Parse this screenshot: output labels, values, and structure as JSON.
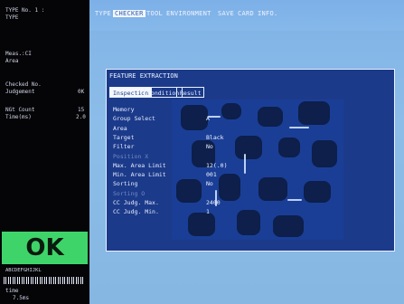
{
  "status": {
    "type_label": "TYPE No. 1 :",
    "type_value": "TYPE",
    "mode_label": "Meas.:CI",
    "mode_value": "Area",
    "checked_label": "Checked No.",
    "judgement_label": "Judgement",
    "judgement_value": "0K",
    "ngcount_label": "NGt Count",
    "ngcount_value": "15",
    "time_label": "Time(ms)",
    "time_value": "2.0",
    "result": "OK",
    "barcode_text": "ABCDEFGHIJKL",
    "bottom_label": "time",
    "bottom_value": "7.5ms"
  },
  "menu": {
    "items": [
      "TYPE",
      "CHECKER",
      "TOOL",
      "ENVIRONMENT",
      "SAVE",
      "CARD",
      "INFO."
    ],
    "active": "CHECKER"
  },
  "dialog": {
    "title": "FEATURE EXTRACTION",
    "tabs": [
      "Inspection",
      "Condition",
      "Result"
    ],
    "active_tab": "Inspection",
    "fields": [
      {
        "label": "Memory",
        "value": ""
      },
      {
        "label": "Group Select",
        "value": "A"
      },
      {
        "label": "Area",
        "value": ""
      },
      {
        "label": "Target",
        "value": "Black"
      },
      {
        "label": "Filter",
        "value": "No"
      },
      {
        "label": "Position X",
        "value": "",
        "dim": true
      },
      {
        "label": "Max. Area Limit",
        "value": "12(.0)"
      },
      {
        "label": "Min. Area Limit",
        "value": "001"
      },
      {
        "label": "Sorting",
        "value": "No"
      },
      {
        "label": "Sorting O",
        "value": "",
        "dim": true
      },
      {
        "label": "CC Judg. Max.",
        "value": "2400"
      },
      {
        "label": "CC Judg. Min.",
        "value": "1"
      }
    ]
  },
  "colors": {
    "ok": "#3fd46a",
    "menu_bg": "#7cb0e7",
    "dialog_bg": "#1c3a8a",
    "left_panel": "#050507"
  }
}
